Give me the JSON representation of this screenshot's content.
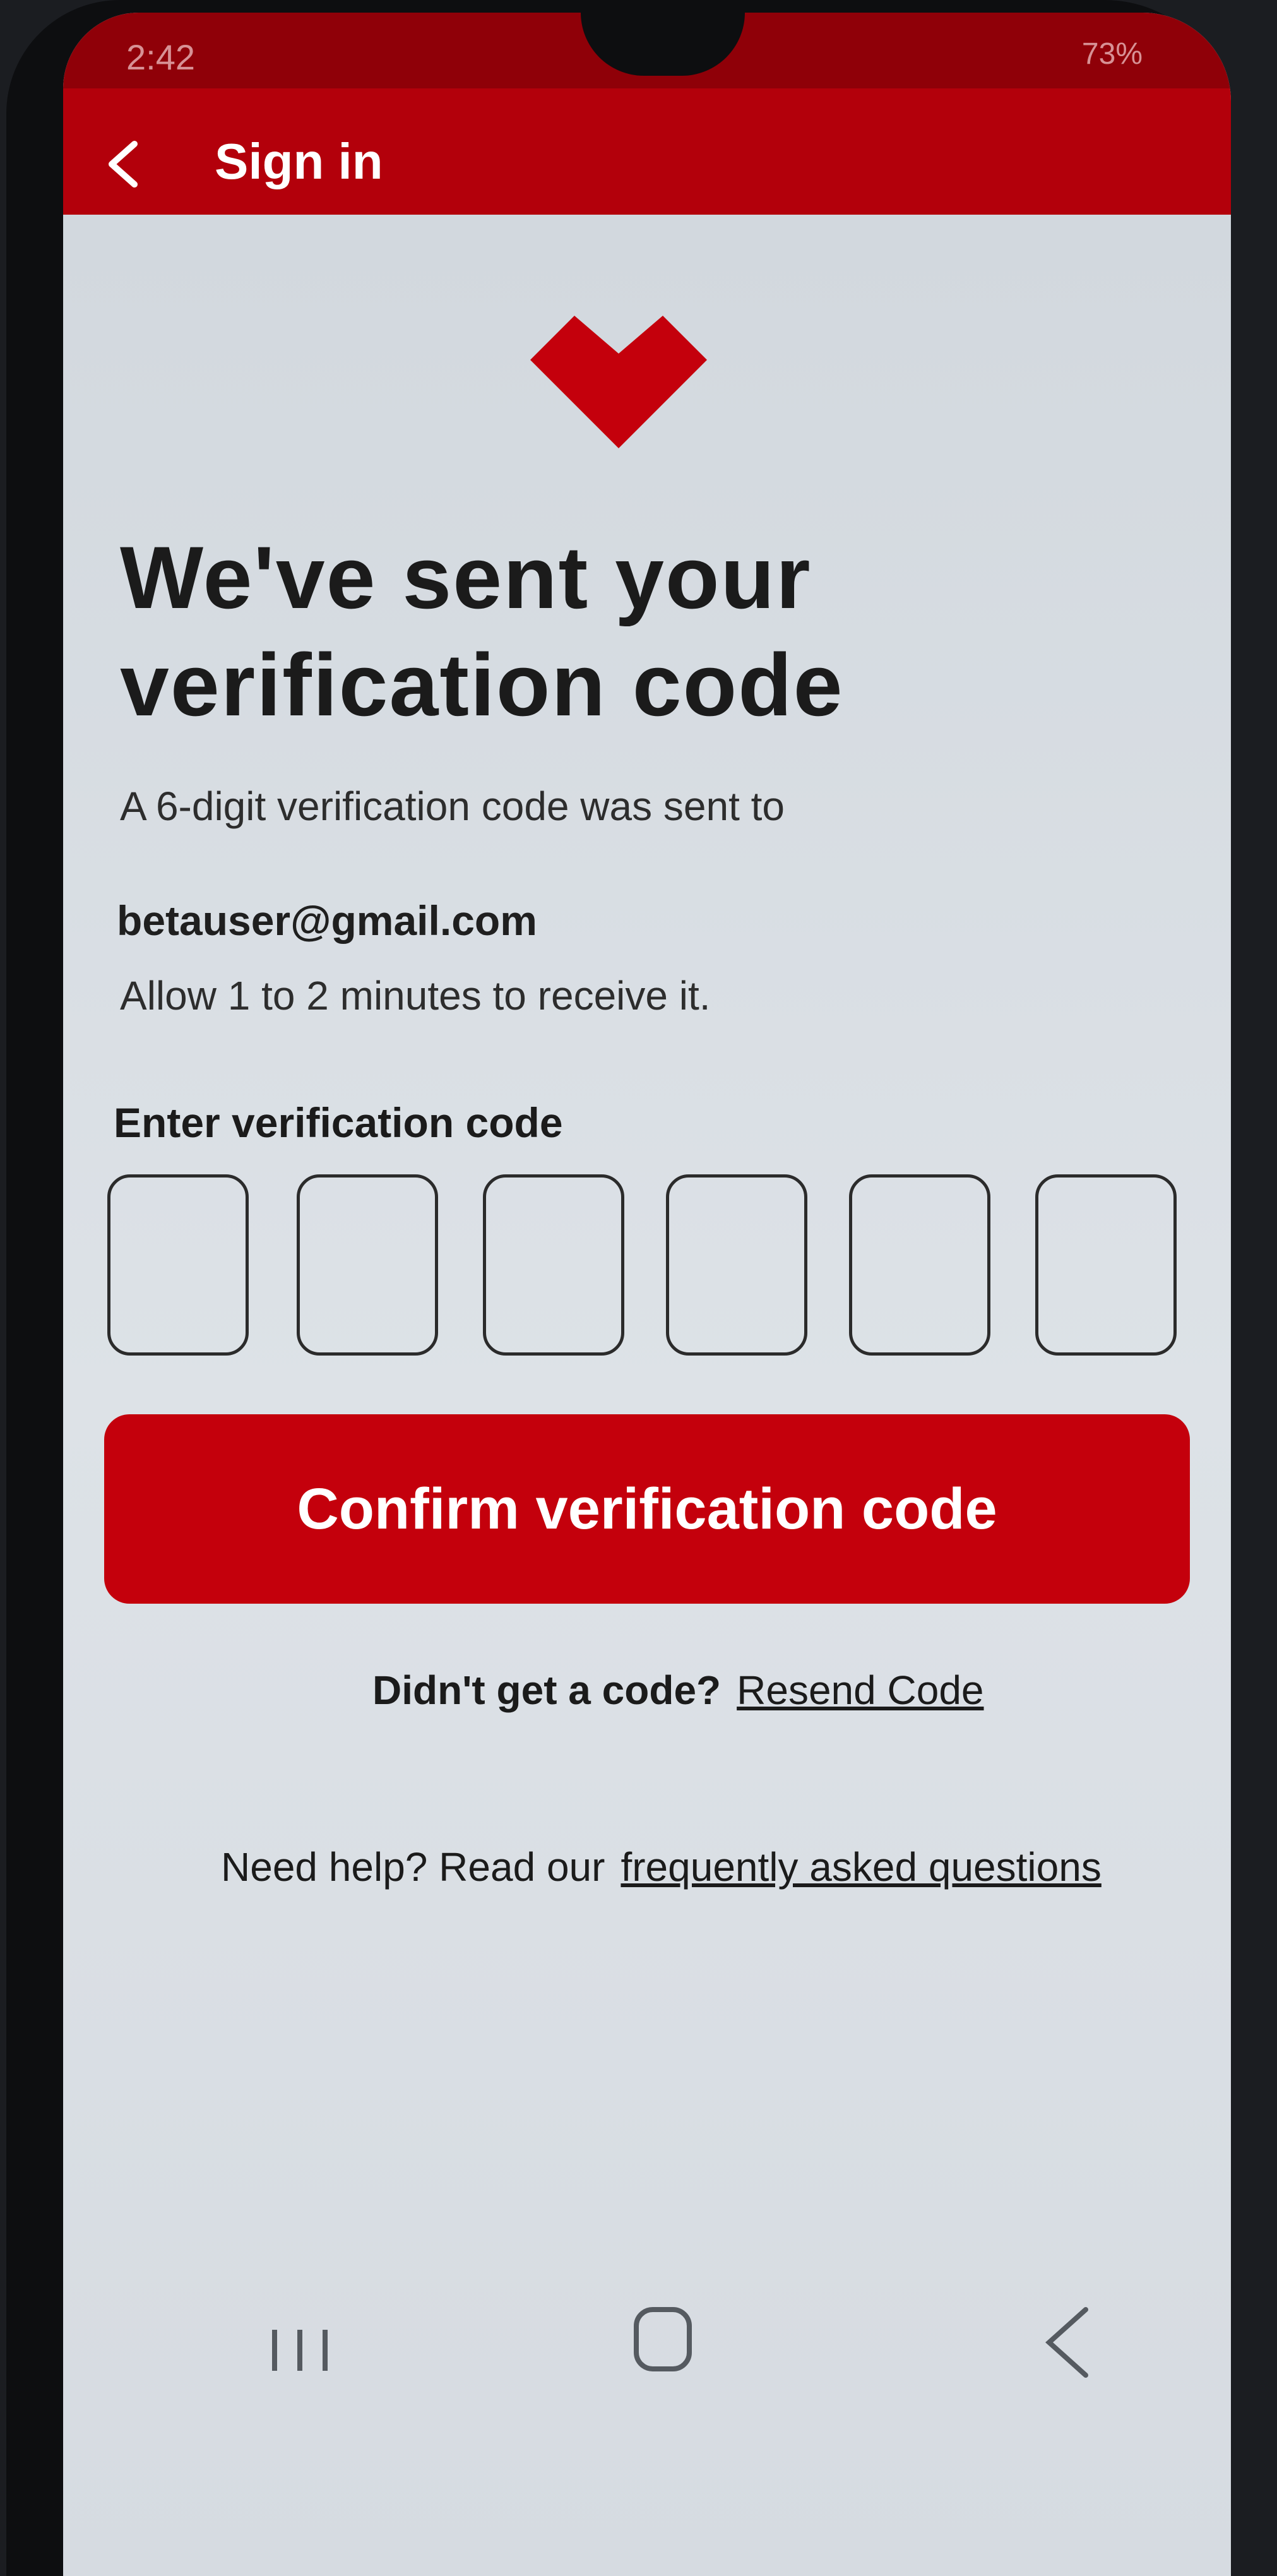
{
  "status_bar": {
    "time": "2:42",
    "battery": "73%"
  },
  "app_bar": {
    "title": "Sign in",
    "back_icon": "chevron-left-icon"
  },
  "brand": {
    "logo_icon": "heart-icon",
    "accent_color": "#c4000c"
  },
  "main": {
    "headline": "We've sent your verification code",
    "subtitle": "A 6-digit verification code was sent to",
    "email": "betauser@gmail.com",
    "note": "Allow 1 to 2 minutes to receive it.",
    "code_label": "Enter verification code",
    "code_digits": [
      "",
      "",
      "",
      "",
      "",
      ""
    ],
    "confirm_button": "Confirm verification code",
    "resend_prompt": "Didn't get a code?",
    "resend_link": "Resend Code",
    "help_prompt": "Need help?  Read our",
    "help_link": "frequently asked questions"
  },
  "nav": {
    "recents_icon": "recents-icon",
    "home_icon": "home-icon",
    "back_icon": "back-icon"
  }
}
